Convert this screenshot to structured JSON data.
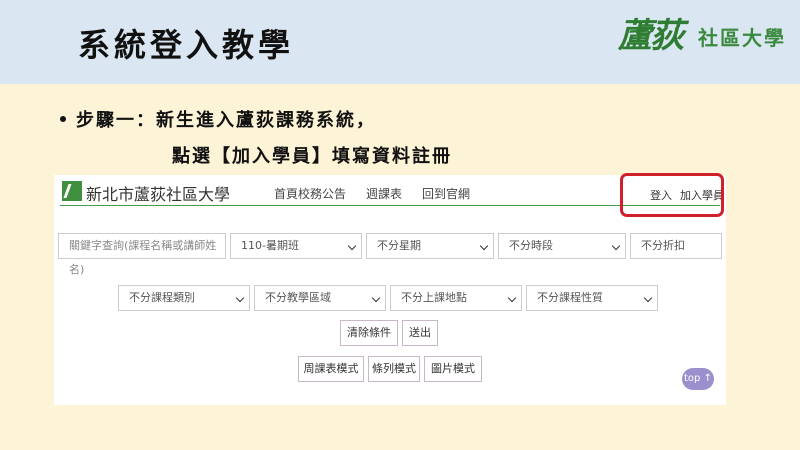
{
  "slide": {
    "title": "系統登入教學",
    "logo_big": "蘆荻",
    "logo_small": "社區大學",
    "bullet_line1": "步驟一：新生進入蘆荻課務系統，",
    "bullet_line2": "點選【加入學員】填寫資料註冊"
  },
  "site": {
    "name": "新北市蘆荻社區大學",
    "nav": [
      "首頁",
      "校務公告",
      "週課表",
      "回到官網"
    ],
    "login": "登入",
    "join": "加入學員"
  },
  "filters": {
    "keyword_placeholder": "關鍵字查詢(課程名稱或講師姓名)",
    "term": "110-暑期班",
    "weekday": "不分星期",
    "time": "不分時段",
    "discount": "不分折扣",
    "category": "不分課程類別",
    "area": "不分教學區域",
    "location": "不分上課地點",
    "nature": "不分課程性質"
  },
  "buttons": {
    "clear": "清除條件",
    "submit": "送出",
    "weekly_mode": "周課表模式",
    "list_mode": "條列模式",
    "image_mode": "圖片模式",
    "top": "top ↑"
  },
  "colors": {
    "header_band": "#dbe6f3",
    "slide_bg": "#fdf3d6",
    "accent_green": "#4c9a4c",
    "highlight_red": "#d0202a",
    "top_button": "#9c8fce"
  }
}
